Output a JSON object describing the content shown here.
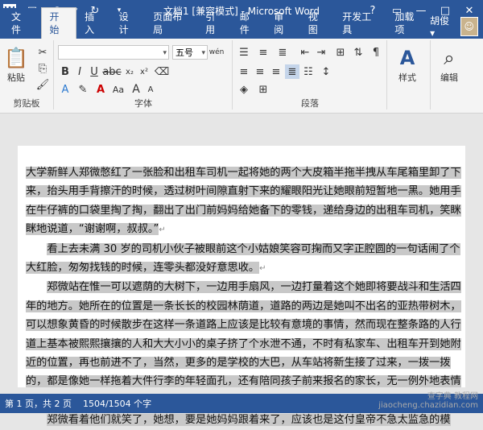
{
  "window": {
    "title": "文档1 [兼容模式] - Microsoft Word",
    "controls": [
      "?",
      "▭",
      "—",
      "□",
      "✕"
    ]
  },
  "tabs": {
    "file": "文件",
    "items": [
      "开始",
      "插入",
      "设计",
      "页面布局",
      "引用",
      "邮件",
      "审阅",
      "视图",
      "开发工具",
      "加载项"
    ],
    "user": "胡俊 ▾"
  },
  "ribbon": {
    "paste_label": "粘贴",
    "clipboard_label": "剪贴板",
    "font_name_value": "",
    "font_size_value": "五号",
    "wen_label": "wén",
    "font_group_label": "字体",
    "paragraph_group_label": "段落",
    "styles_label": "样式",
    "editing_label": "编辑"
  },
  "document": {
    "paragraphs": [
      "大学新鲜人郑微憋红了一张脸和出租车司机一起将她的两个大皮箱半拖半拽从车尾箱里卸了下来，抬头用手背擦汗的时候，透过树叶间隙直射下来的耀眼阳光让她眼前短暂地一黑。她用手在牛仔裤的口袋里掏了掏，翻出了出门前妈妈给她备下的零钱，递给身边的出租车司机，笑眯眯地说道，“谢谢啊，叔叔。”",
      "看上去未满 30 岁的司机小伙子被眼前这个小姑娘笑容可掬而又字正腔圆的一句话闹了个大红脸，匆匆找钱的时候，连零头都没好意思收。",
      "郑微站在惟一可以遮荫的大树下，一边用手扇风，一边打量着这个她即将要战斗和生活四年的地方。她所在的位置是一条长长的校园林荫道，道路的两边是她叫不出名的亚热带树木，可以想象黄昏的时候散步在这样一条道路上应该是比较有意境的事情，然而现在整条路的人行道上基本被熙熙攘攘的人和大大小小的桌子挤了个水泄不通，不时有私家车、出租车开到她附近的位置，再也前进不了，当然，更多的是学校的大巴，从车站将新生接了过来，一拨一拨的，都是像她一样拖着大件行李的年轻面孔，还有陪同孩子前来报名的家长，无一例外地表情比学生更焦急凝重。",
      "郑微看着他们就笑了，她想，要是她妈妈跟着来了，应该也是这付皇帝不急太监急的模"
    ]
  },
  "status": {
    "page": "第 1 页，共 2 页",
    "words": "1504/1504 个字"
  },
  "watermark": "查字典 教程网\njiaocheng.chazidian.com"
}
